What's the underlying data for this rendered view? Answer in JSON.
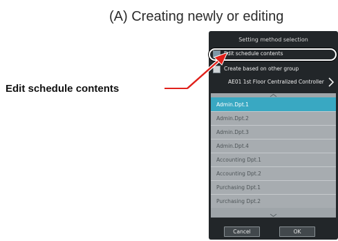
{
  "document": {
    "title": "(A) Creating newly or editing",
    "callout_label": "Edit schedule contents"
  },
  "dialog": {
    "header": "Setting method selection",
    "options": [
      {
        "label": "Edit schedule contents",
        "checked": true
      },
      {
        "label": "Create based on other group",
        "checked": false
      }
    ],
    "controller": "AE01 1st Floor Centralized Controller",
    "groups": [
      {
        "label": "Admin.Dpt.1",
        "selected": true
      },
      {
        "label": "Admin.Dpt.2",
        "selected": false
      },
      {
        "label": "Admin.Dpt.3",
        "selected": false
      },
      {
        "label": "Admin.Dpt.4",
        "selected": false
      },
      {
        "label": "Accounting Dpt.1",
        "selected": false
      },
      {
        "label": "Accounting Dpt.2",
        "selected": false
      },
      {
        "label": "Purchasing Dpt.1",
        "selected": false
      },
      {
        "label": "Purchasing Dpt.2",
        "selected": false
      }
    ],
    "buttons": {
      "cancel": "Cancel",
      "ok": "OK"
    }
  },
  "colors": {
    "selected_row": "#39a8c2",
    "callout_red": "#e0201a",
    "panel_bg": "#222629"
  },
  "icons": {
    "controller_next": "chevron-right-icon",
    "scroll_up": "chevron-up-icon",
    "scroll_down": "chevron-down-icon"
  }
}
